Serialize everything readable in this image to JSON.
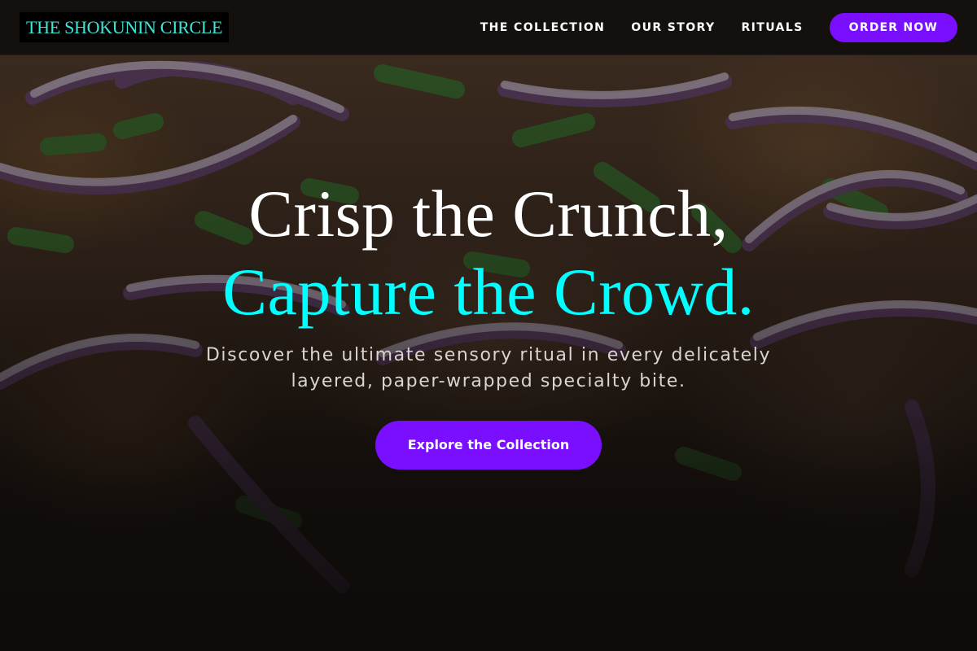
{
  "brand": {
    "name": "THE SHOKUNIN CIRCLE"
  },
  "nav": {
    "links": [
      "THE COLLECTION",
      "OUR STORY",
      "RITUALS"
    ],
    "cta_label": "ORDER NOW"
  },
  "hero": {
    "headline_line1": "Crisp the Crunch,",
    "headline_line2": "Capture the Crowd.",
    "subtitle": "Discover the ultimate sensory ritual in every delicately layered, paper-wrapped specialty bite.",
    "cta_label": "Explore the Collection"
  },
  "colors": {
    "accent": "#7A0FFF",
    "highlight": "#00FFFF",
    "logo_text": "#3EE6D6",
    "text": "#FFFFFF",
    "subtitle": "#D8D4D0",
    "nav_bg": "#100E0D"
  }
}
